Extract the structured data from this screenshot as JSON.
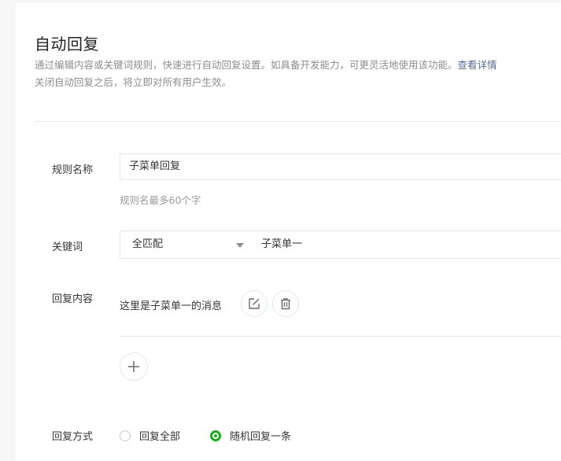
{
  "header": {
    "title": "自动回复",
    "desc_line1": "通过编辑内容或关键词规则，快速进行自动回复设置。如具备开发能力，可更灵活地使用该功能。",
    "desc_link": "查看详情",
    "desc_line2": "关闭自动回复之后，将立即对所有用户生效。"
  },
  "rule_name": {
    "label": "规则名称",
    "value": "子菜单回复",
    "hint": "规则名最多60个字"
  },
  "keyword": {
    "label": "关键词",
    "match_mode": "全匹配",
    "value": "子菜单一"
  },
  "reply": {
    "label": "回复内容",
    "text": "这里是子菜单一的消息"
  },
  "reply_mode": {
    "label": "回复方式",
    "options": [
      {
        "label": "回复全部",
        "selected": false
      },
      {
        "label": "随机回复一条",
        "selected": true
      }
    ]
  },
  "colors": {
    "accent": "#1aad19",
    "link": "#576b95"
  }
}
